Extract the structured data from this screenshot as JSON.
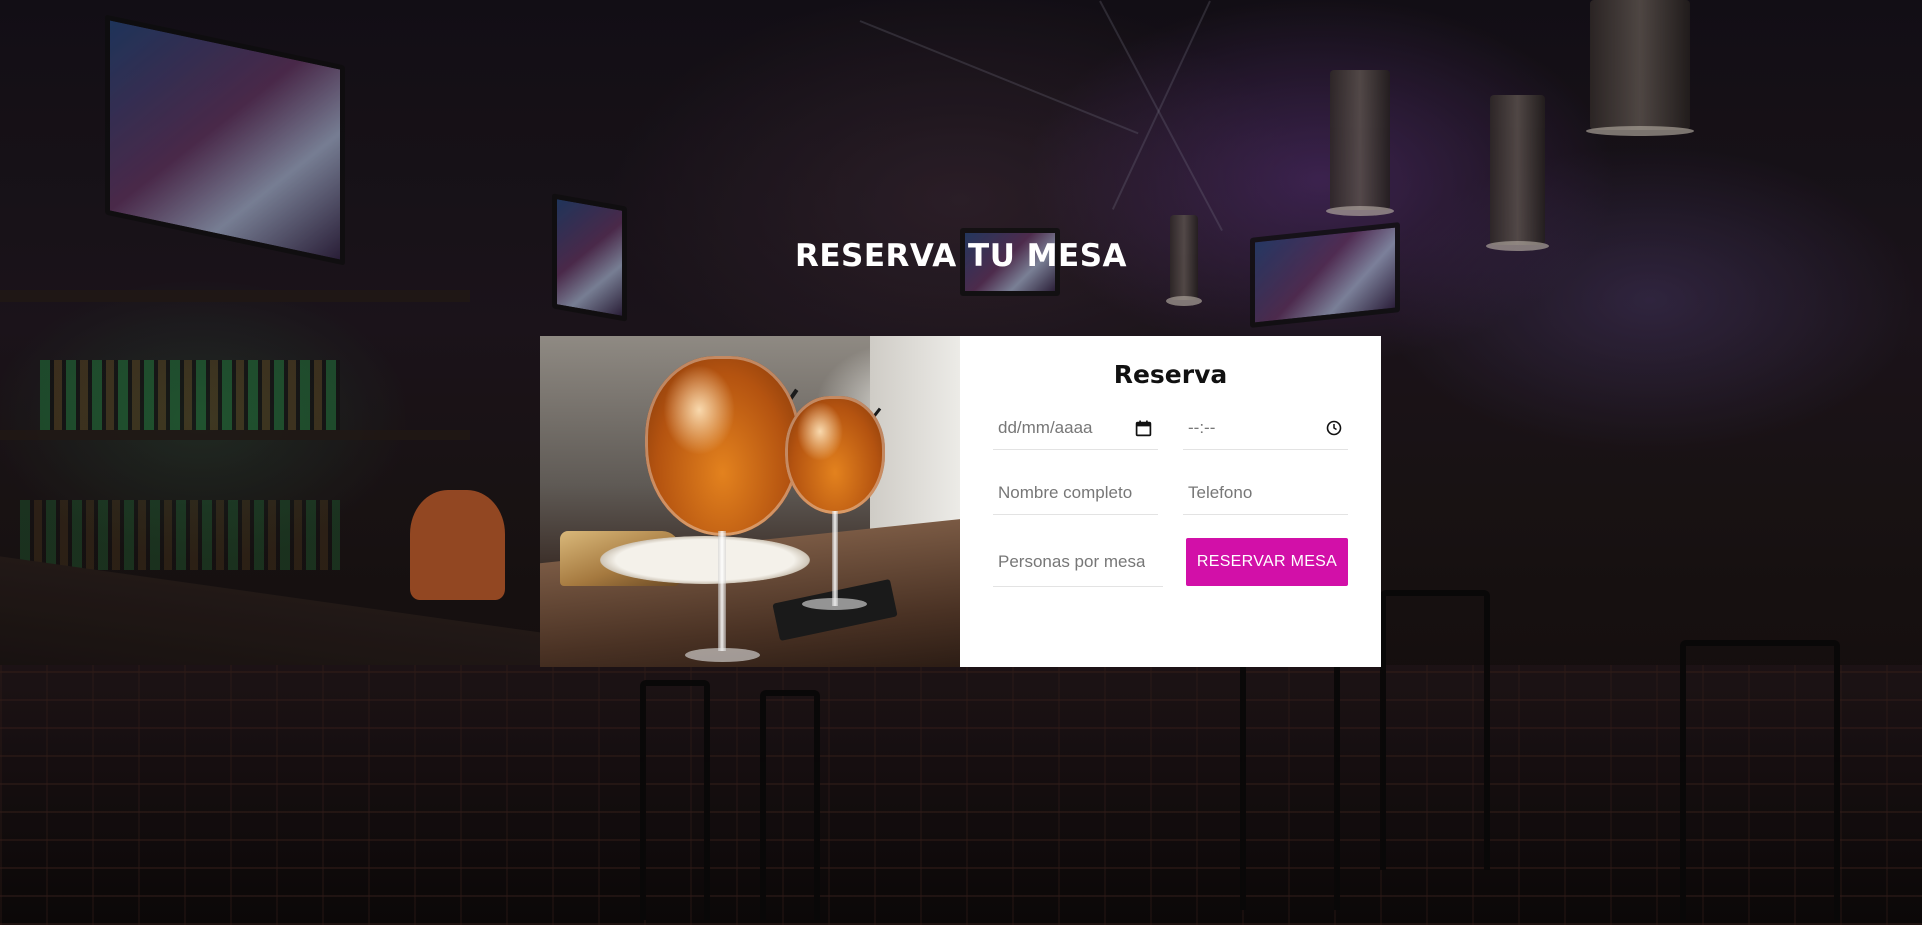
{
  "page": {
    "heading": "RESERVA TU MESA"
  },
  "form": {
    "title": "Reserva",
    "date_placeholder": "dd/mm/aaaa",
    "time_placeholder": "--:--",
    "name_placeholder": "Nombre completo",
    "phone_placeholder": "Telefono",
    "people_placeholder": "Personas por mesa",
    "submit_label": "RESERVAR MESA"
  },
  "icons": {
    "date": "calendar-icon",
    "time": "clock-icon"
  },
  "colors": {
    "accent": "#d210a8",
    "card_background": "#ffffff",
    "heading_text": "#ffffff"
  }
}
